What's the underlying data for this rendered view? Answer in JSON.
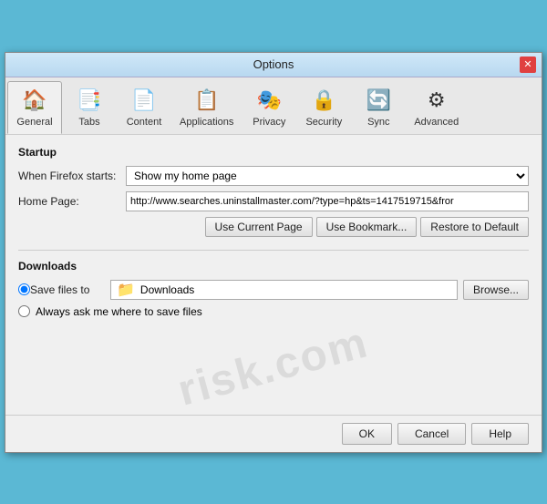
{
  "window": {
    "title": "Options",
    "close_label": "✕"
  },
  "toolbar": {
    "items": [
      {
        "id": "general",
        "label": "General",
        "icon": "🏠",
        "active": true
      },
      {
        "id": "tabs",
        "label": "Tabs",
        "icon": "📑",
        "active": false
      },
      {
        "id": "content",
        "label": "Content",
        "icon": "📄",
        "active": false
      },
      {
        "id": "applications",
        "label": "Applications",
        "icon": "📋",
        "active": false
      },
      {
        "id": "privacy",
        "label": "Privacy",
        "icon": "🎭",
        "active": false
      },
      {
        "id": "security",
        "label": "Security",
        "icon": "🔒",
        "active": false
      },
      {
        "id": "sync",
        "label": "Sync",
        "icon": "🔄",
        "active": false
      },
      {
        "id": "advanced",
        "label": "Advanced",
        "icon": "⚙",
        "active": false
      }
    ]
  },
  "startup": {
    "section_label": "Startup",
    "when_label": "When Firefox starts:",
    "when_value": "Show my home page",
    "home_label": "Home Page:",
    "home_value": "http://www.searches.uninstallmaster.com/?type=hp&ts=1417519715&fror",
    "use_current_label": "Use Current Page",
    "use_bookmark_label": "Use Bookmark...",
    "restore_label": "Restore to Default"
  },
  "downloads": {
    "section_label": "Downloads",
    "save_radio_label": "Save files to",
    "save_path": "Downloads",
    "save_path_icon": "📁",
    "browse_label": "Browse...",
    "ask_radio_label": "Always ask me where to save files"
  },
  "footer": {
    "ok_label": "OK",
    "cancel_label": "Cancel",
    "help_label": "Help"
  },
  "watermark": "risk.com"
}
